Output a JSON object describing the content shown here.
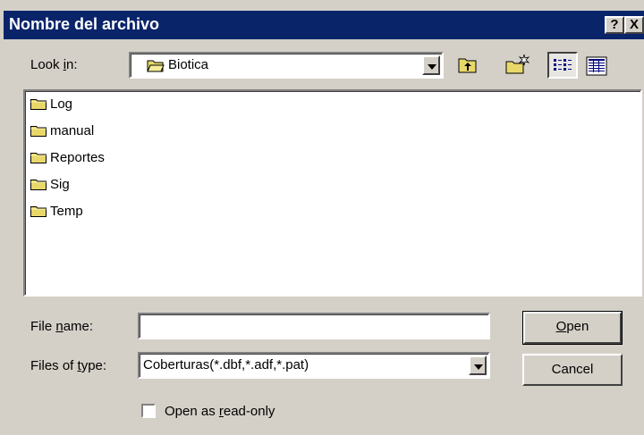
{
  "window": {
    "title": "Nombre del archivo",
    "help_button": "?",
    "close_button": "X"
  },
  "look_in": {
    "label_pre": "Look ",
    "label_u": "i",
    "label_post": "n:",
    "value": "Biotica"
  },
  "toolbar": {
    "up_folder": "up-one-level-icon",
    "new_folder": "create-new-folder-icon",
    "list_view": "list-view-icon",
    "details_view": "details-view-icon"
  },
  "file_list": {
    "items": [
      {
        "name": "Log"
      },
      {
        "name": "manual"
      },
      {
        "name": "Reportes"
      },
      {
        "name": "Sig"
      },
      {
        "name": "Temp"
      }
    ]
  },
  "file_name": {
    "label_pre": "File ",
    "label_u": "n",
    "label_post": "ame:",
    "value": ""
  },
  "file_type": {
    "label_pre": "Files of ",
    "label_u": "t",
    "label_post": "ype:",
    "value": "Coberturas(*.dbf,*.adf,*.pat)"
  },
  "buttons": {
    "open_u": "O",
    "open_rest": "pen",
    "cancel": "Cancel"
  },
  "read_only": {
    "label_pre": "Open as ",
    "label_u": "r",
    "label_post": "ead-only",
    "checked": false
  }
}
